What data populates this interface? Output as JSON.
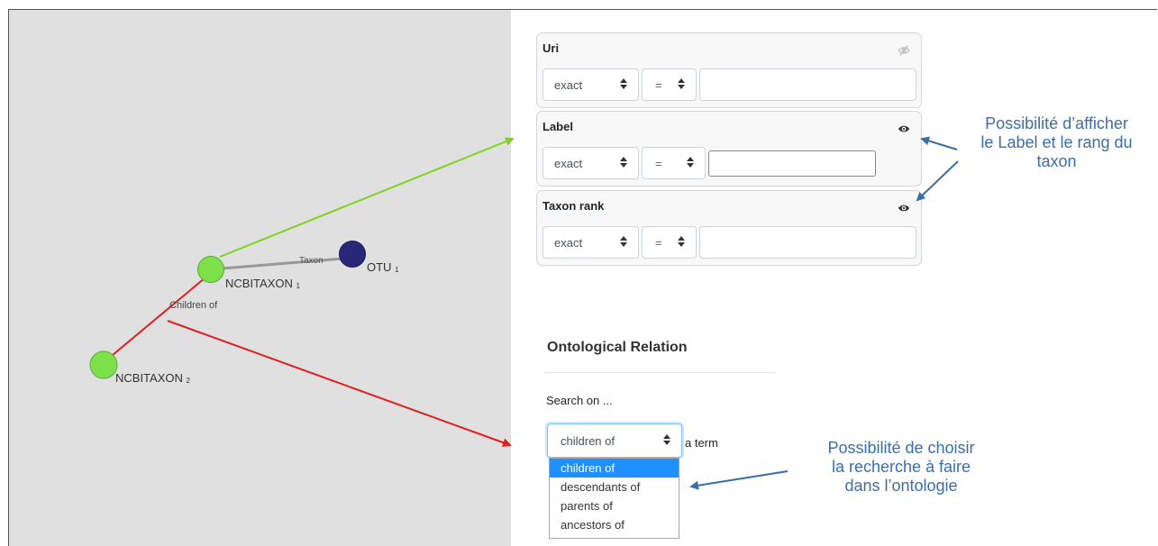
{
  "graph": {
    "nodes": [
      {
        "label": "NCBITAXON",
        "sub": "1",
        "color": "#7be04a"
      },
      {
        "label": "OTU",
        "sub": "1",
        "color": "#2a2a80"
      },
      {
        "label": "NCBITAXON",
        "sub": "2",
        "color": "#7be04a"
      }
    ],
    "edges": [
      {
        "label": "Taxon",
        "color": "#999999"
      },
      {
        "label": "Children of",
        "color": "#e02020"
      }
    ]
  },
  "attributes": [
    {
      "title": "Uri",
      "visible": false,
      "match": "exact",
      "compare": "=",
      "value": ""
    },
    {
      "title": "Label",
      "visible": true,
      "match": "exact",
      "compare": "=",
      "value": ""
    },
    {
      "title": "Taxon rank",
      "visible": true,
      "match": "exact",
      "compare": "=",
      "value": ""
    }
  ],
  "ontology": {
    "title": "Ontological Relation",
    "search_on": "Search on ...",
    "selected": "children of",
    "suffix": "a term",
    "options": [
      "children of",
      "descendants of",
      "parents of",
      "ancestors of"
    ]
  },
  "annotations": {
    "label_rank": [
      "Possibilité d’afficher",
      "le Label et le rang du",
      "taxon"
    ],
    "search_type": [
      "Possibilité de choisir",
      "la recherche à faire",
      "dans l’ontologie"
    ]
  },
  "colors": {
    "green_arrow": "#7ed321",
    "red_arrow": "#e02020",
    "callout_text": "#3c6ea6",
    "option_selected_bg": "#1e90ff"
  },
  "icons": {
    "visible": "eye-icon",
    "hidden": "eye-slash-icon",
    "select": "up-down-caret-icon"
  }
}
